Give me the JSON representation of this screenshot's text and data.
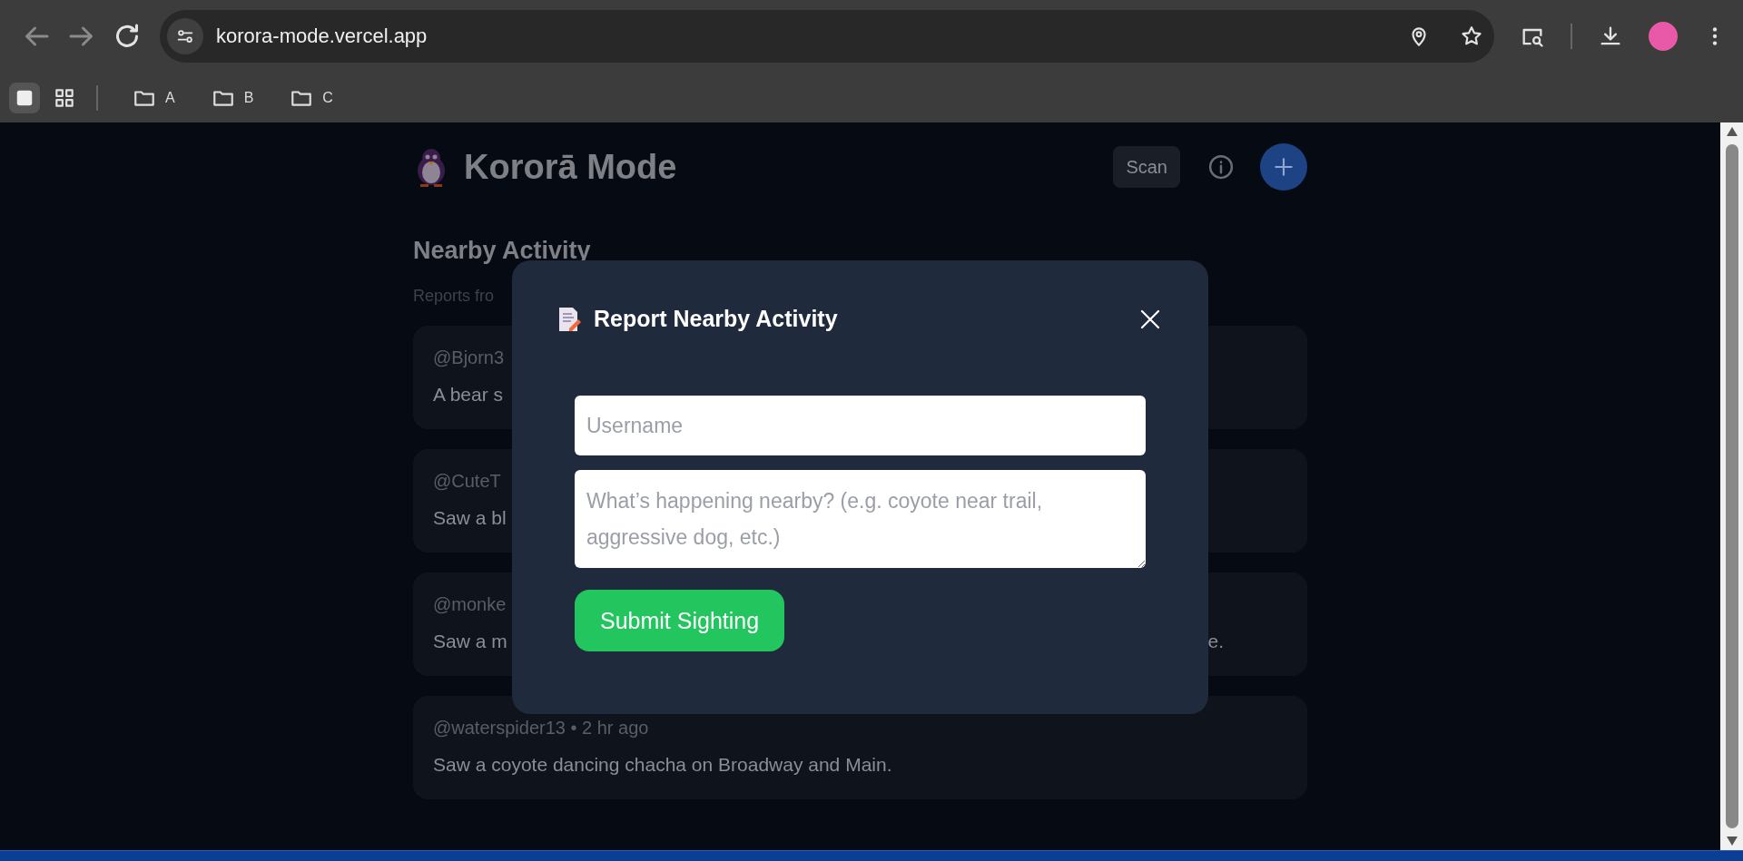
{
  "browser": {
    "url": "korora-mode.vercel.app",
    "bookmarks": [
      {
        "label": "A"
      },
      {
        "label": "B"
      },
      {
        "label": "C"
      }
    ]
  },
  "app": {
    "title": "Kororā Mode",
    "scan_button": "Scan",
    "section_title": "Nearby Activity",
    "section_subtitle": "Reports fro",
    "posts": [
      {
        "meta": "@Bjorn3",
        "text": "A bear s"
      },
      {
        "meta": "@CuteT",
        "text": "Saw a bl"
      },
      {
        "meta": "@monke",
        "text": "Saw a m",
        "text_end": "e."
      },
      {
        "meta": "@waterspider13 • 2 hr ago",
        "text": "Saw a coyote dancing chacha on Broadway and Main."
      }
    ]
  },
  "modal": {
    "title": "Report Nearby Activity",
    "fields": [
      {
        "kind": "input",
        "placeholder": "Username"
      },
      {
        "kind": "textarea",
        "placeholder": "What’s happening nearby? (e.g. coyote near trail, aggressive dog, etc.)"
      }
    ],
    "submit": "Submit Sighting"
  }
}
